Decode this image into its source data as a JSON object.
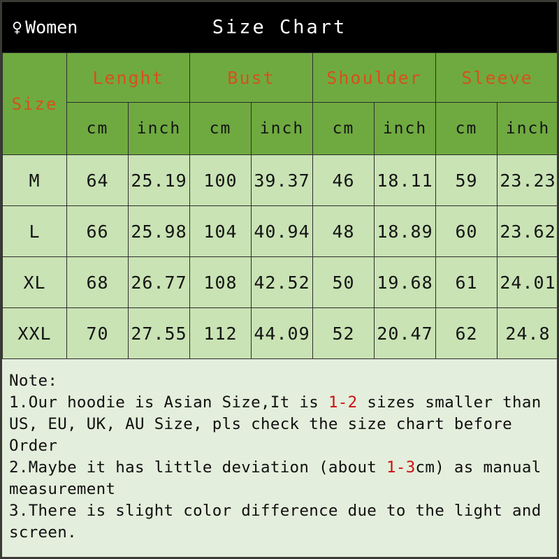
{
  "banner": {
    "gender_icon": "venus-icon",
    "gender_label": "Women",
    "title": "Size Chart"
  },
  "table": {
    "size_header": "Size",
    "groups": [
      "Lenght",
      "Bust",
      "Shoulder",
      "Sleeve"
    ],
    "units": [
      "cm",
      "inch",
      "cm",
      "inch",
      "cm",
      "inch",
      "cm",
      "inch"
    ],
    "rows": [
      {
        "size": "M",
        "values": [
          "64",
          "25.19",
          "100",
          "39.37",
          "46",
          "18.11",
          "59",
          "23.23"
        ]
      },
      {
        "size": "L",
        "values": [
          "66",
          "25.98",
          "104",
          "40.94",
          "48",
          "18.89",
          "60",
          "23.62"
        ]
      },
      {
        "size": "XL",
        "values": [
          "68",
          "26.77",
          "108",
          "42.52",
          "50",
          "19.68",
          "61",
          "24.01"
        ]
      },
      {
        "size": "XXL",
        "values": [
          "70",
          "27.55",
          "112",
          "44.09",
          "52",
          "20.47",
          "62",
          "24.8"
        ]
      }
    ]
  },
  "note": {
    "title": "Note:",
    "line1_a": "1.Our hoodie is Asian Size,It is ",
    "line1_hl": "1-2",
    "line1_b": " sizes smaller than US, EU, UK, AU Size, pls check the size chart before Order",
    "line2_a": "2.Maybe it has little deviation (about ",
    "line2_hl": "1-3",
    "line2_b": "cm) as manual measurement",
    "line3": "3.There is slight color difference due to the light and screen."
  },
  "colors": {
    "banner_bg": "#000000",
    "header_green": "#6faa40",
    "cell_green": "#c9e3b4",
    "note_bg": "#e4eedc",
    "accent_orange": "#d4521c",
    "highlight_red": "#cc1111",
    "border": "#2d2d2d"
  }
}
